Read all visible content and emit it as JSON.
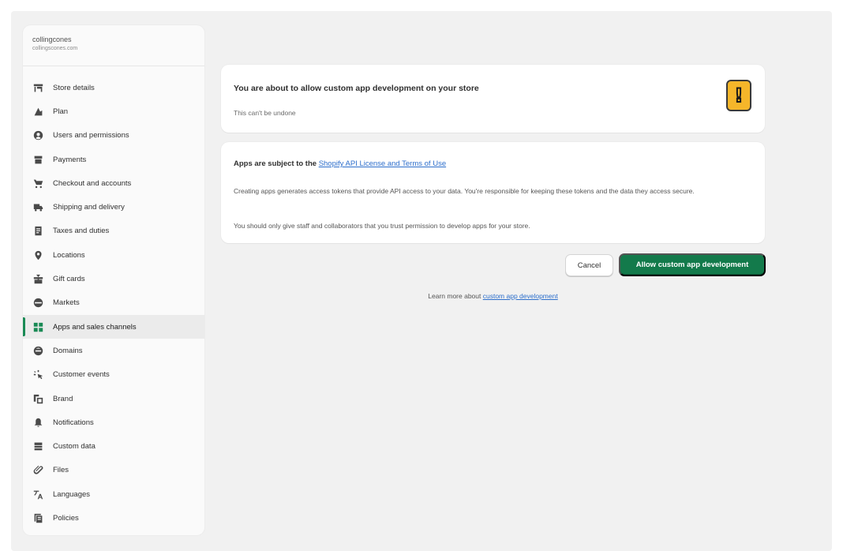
{
  "store": {
    "name": "collingcones",
    "domain": "collingscones.com"
  },
  "sidebar": {
    "items": [
      {
        "label": "Store details",
        "icon": "store-icon"
      },
      {
        "label": "Plan",
        "icon": "plan-icon"
      },
      {
        "label": "Users and permissions",
        "icon": "user-icon"
      },
      {
        "label": "Payments",
        "icon": "payments-icon"
      },
      {
        "label": "Checkout and accounts",
        "icon": "cart-icon"
      },
      {
        "label": "Shipping and delivery",
        "icon": "truck-icon"
      },
      {
        "label": "Taxes and duties",
        "icon": "tax-icon"
      },
      {
        "label": "Locations",
        "icon": "location-icon"
      },
      {
        "label": "Gift cards",
        "icon": "gift-icon"
      },
      {
        "label": "Markets",
        "icon": "globe-icon"
      },
      {
        "label": "Apps and sales channels",
        "icon": "apps-icon",
        "active": true
      },
      {
        "label": "Domains",
        "icon": "domains-icon"
      },
      {
        "label": "Customer events",
        "icon": "events-icon"
      },
      {
        "label": "Brand",
        "icon": "brand-icon"
      },
      {
        "label": "Notifications",
        "icon": "bell-icon"
      },
      {
        "label": "Custom data",
        "icon": "database-icon"
      },
      {
        "label": "Files",
        "icon": "paperclip-icon"
      },
      {
        "label": "Languages",
        "icon": "language-icon"
      },
      {
        "label": "Policies",
        "icon": "policies-icon"
      }
    ]
  },
  "warning_card": {
    "title": "You are about to allow custom app development on your store",
    "subtitle": "This can't be undone",
    "icon": "warning-icon"
  },
  "terms_card": {
    "heading_prefix": "Apps are subject to the ",
    "heading_link": "Shopify API License and Terms of Use",
    "paragraph1": "Creating apps generates access tokens that provide API access to your data. You're responsible for keeping these tokens and the data they access secure.",
    "paragraph2": "You should only give staff and collaborators that you trust permission to develop apps for your store."
  },
  "actions": {
    "cancel": "Cancel",
    "allow": "Allow custom app development"
  },
  "learn_more": {
    "prefix": "Learn more about ",
    "link": "custom app development"
  },
  "colors": {
    "primary_button": "#137a4b",
    "active_indicator": "#1a8a55",
    "link": "#2c6ecb",
    "warning": "#f5b62a"
  }
}
